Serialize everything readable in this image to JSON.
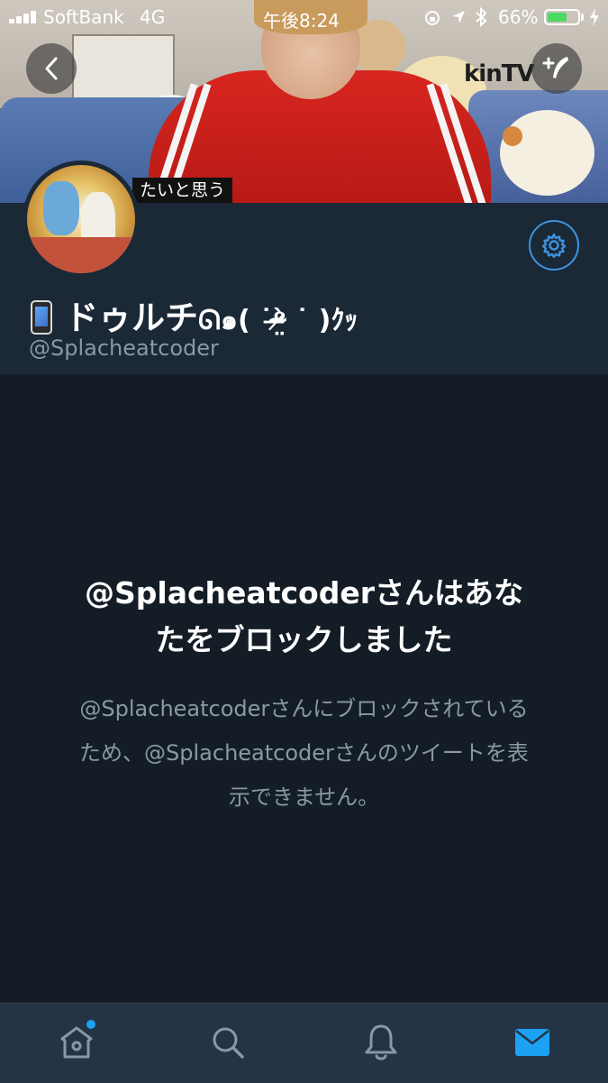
{
  "status_bar": {
    "carrier": "SoftBank",
    "network": "4G",
    "time": "午後8:24",
    "battery_percent": "66%",
    "battery_level": 0.66
  },
  "banner": {
    "caption": "たいと思う",
    "tv_text": "kinTV"
  },
  "profile": {
    "display_name": "ドゥルチ",
    "name_emoticon": "ᘏ๑( ˙ᵒ̴̶̷̤̀ ˙ )ｸｯ",
    "handle": "@Splacheatcoder"
  },
  "blocked": {
    "title_line1": "@Splacheatcoderさんはあな",
    "title_line2": "たをブロックしました",
    "desc_line1": "@Splacheatcoderさんにブロックされている",
    "desc_line2": "ため、@Splacheatcoderさんのツイートを表",
    "desc_line3": "示できません。"
  },
  "icons": {
    "back": "chevron-left-icon",
    "compose": "compose-icon",
    "settings": "gear-icon",
    "home": "home-icon",
    "search": "search-icon",
    "notifications": "bell-icon",
    "messages": "mail-icon"
  },
  "colors": {
    "accent": "#1da1f2",
    "background": "#141d26",
    "panel": "#1b2836",
    "muted_text": "#8899a6"
  }
}
